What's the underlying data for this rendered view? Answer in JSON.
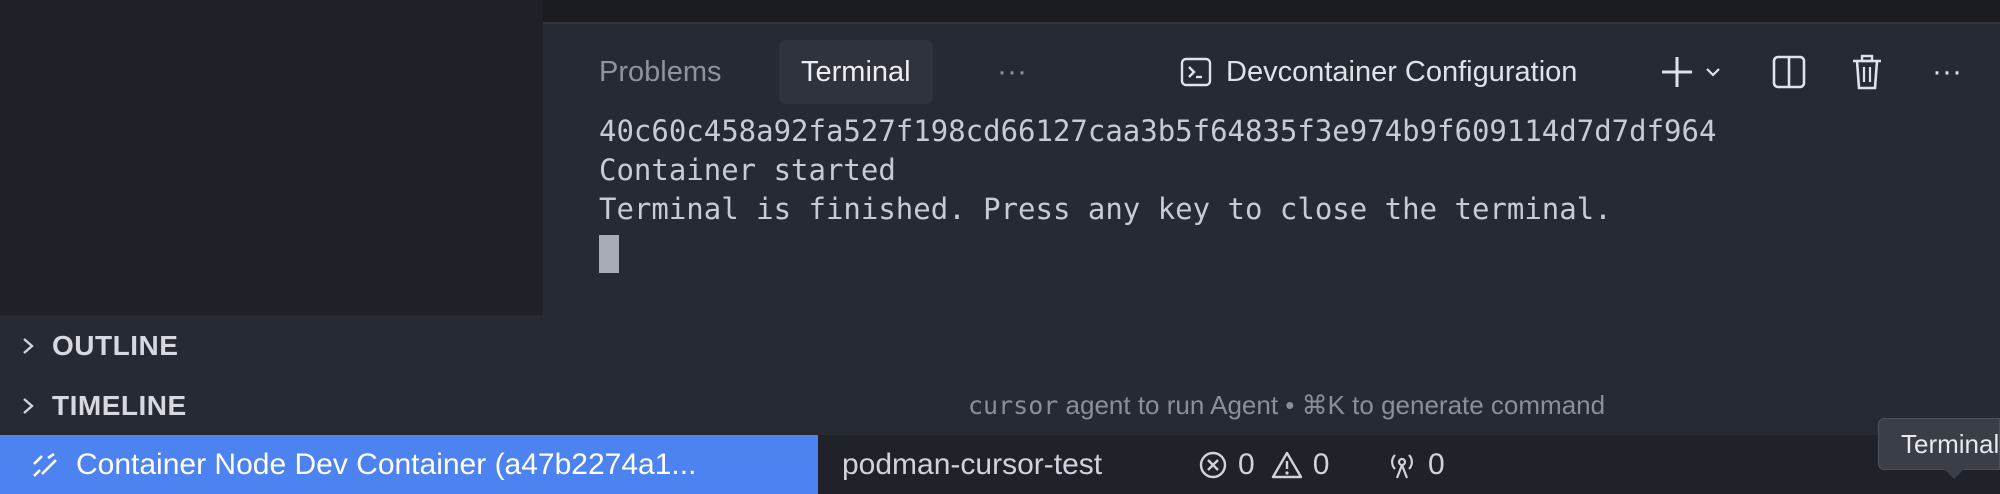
{
  "sidebar": {
    "sections": [
      {
        "label": "OUTLINE"
      },
      {
        "label": "TIMELINE"
      }
    ]
  },
  "panel": {
    "tabs": [
      {
        "label": "Problems",
        "active": false
      },
      {
        "label": "Terminal",
        "active": true
      }
    ],
    "more_tabs_label": "···",
    "terminal_title": "Devcontainer Configuration",
    "icons": [
      "terminal-icon",
      "plus-icon",
      "chevron-down-icon",
      "split-icon",
      "trash-icon",
      "more-icon"
    ]
  },
  "terminal": {
    "lines": [
      "40c60c458a92fa527f198cd66127caa3b5f64835f3e974b9f609114d7d7df964",
      "Container started",
      "",
      "",
      "Terminal is finished. Press any key to close the terminal."
    ],
    "hint_command": "cursor",
    "hint_text": " agent to run Agent • ⌘K to generate command"
  },
  "statusbar": {
    "remote_label": "Container Node Dev Container (a47b2274a1...",
    "workspace": "podman-cursor-test",
    "errors": "0",
    "warnings": "0",
    "ports": "0",
    "accent_color": "#4d83f0"
  },
  "tooltip": {
    "text": "Terminal"
  }
}
